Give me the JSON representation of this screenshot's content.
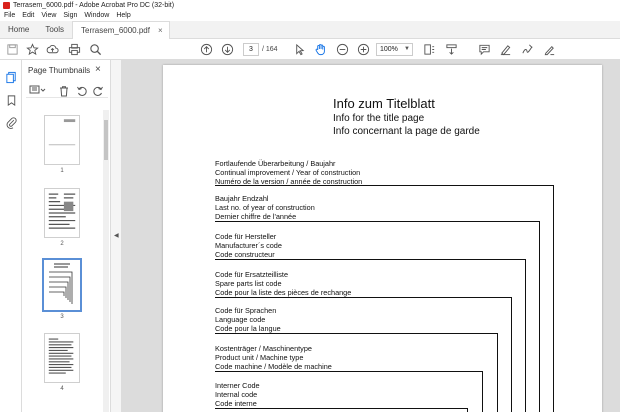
{
  "window": {
    "title": "Terrasem_6000.pdf - Adobe Acrobat Pro DC (32-bit)"
  },
  "menu": [
    "File",
    "Edit",
    "View",
    "Sign",
    "Window",
    "Help"
  ],
  "tabs": {
    "home": "Home",
    "tools": "Tools",
    "document": "Terrasem_6000.pdf",
    "close": "×"
  },
  "toolbar": {
    "current_page": "3",
    "page_count": "/ 164",
    "zoom": "100%"
  },
  "panel": {
    "title": "Page Thumbnails",
    "close": "×",
    "thumbnails": [
      "1",
      "2",
      "3",
      "4"
    ]
  },
  "colors": {
    "accent": "#5a8fd6",
    "brand": "#d9221c",
    "active_tool": "#1473e6"
  },
  "doc": {
    "heading": [
      "Info  zum  Titelblatt",
      "Info for the title page",
      "Info concernant la page de garde"
    ],
    "blocks": [
      [
        "Fortlaufende Überarbeitung / Baujahr",
        "Continual improvement / Year of construction",
        "Numéro de la version / année de construction"
      ],
      [
        "Baujahr Endzahl",
        "Last no. of year of construction",
        "Dernier chiffre de l'année"
      ],
      [
        "Code für Hersteller",
        "Manufacturer´s  code",
        "Code constructeur"
      ],
      [
        "Code für Ersatzteilliste",
        "Spare parts list code",
        "Code pour la liste des pièces de rechange"
      ],
      [
        "Code für Sprachen",
        "Language code",
        "Code pour la langue"
      ],
      [
        "Kostenträger / Maschinentype",
        "Product unit / Machine type",
        "Code machine / Modèle de machine"
      ],
      [
        "Interner Code",
        "Internal code",
        "Code interne"
      ]
    ]
  }
}
